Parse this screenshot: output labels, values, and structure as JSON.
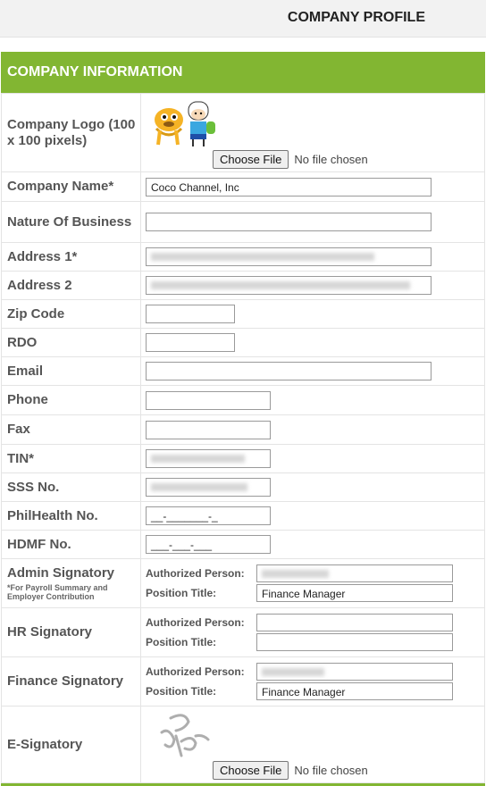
{
  "page": {
    "title": "COMPANY PROFILE"
  },
  "section": {
    "title": "COMPANY INFORMATION"
  },
  "colors": {
    "accent": "#82b632"
  },
  "logo": {
    "label": "Company Logo (100 x 100 pixels)",
    "choose": "Choose File",
    "status": "No file chosen"
  },
  "fields": {
    "company_name": {
      "label": "Company Name*",
      "value": "Coco Channel, Inc"
    },
    "nature": {
      "label": "Nature Of Business",
      "value": ""
    },
    "address1": {
      "label": "Address 1*"
    },
    "address2": {
      "label": "Address 2"
    },
    "zip": {
      "label": "Zip Code",
      "value": ""
    },
    "rdo": {
      "label": "RDO",
      "value": ""
    },
    "email": {
      "label": "Email",
      "value": ""
    },
    "phone": {
      "label": "Phone",
      "value": ""
    },
    "fax": {
      "label": "Fax",
      "value": ""
    },
    "tin": {
      "label": "TIN*"
    },
    "sss": {
      "label": "SSS No."
    },
    "philhealth": {
      "label": "PhilHealth No.",
      "value": "__-_______-_"
    },
    "hdmf": {
      "label": "HDMF No.",
      "value": "___-___-___"
    }
  },
  "signatories": {
    "admin": {
      "label": "Admin Signatory",
      "note": "*For Payroll Summary and Employer Contribution",
      "auth_label": "Authorized Person:",
      "pos_label": "Position Title:",
      "position": "Finance Manager"
    },
    "hr": {
      "label": "HR Signatory",
      "auth_label": "Authorized Person:",
      "pos_label": "Position Title:",
      "position": ""
    },
    "finance": {
      "label": "Finance Signatory",
      "auth_label": "Authorized Person:",
      "pos_label": "Position Title:",
      "position": "Finance Manager"
    }
  },
  "esig": {
    "label": "E-Signatory",
    "choose": "Choose File",
    "status": "No file chosen"
  }
}
